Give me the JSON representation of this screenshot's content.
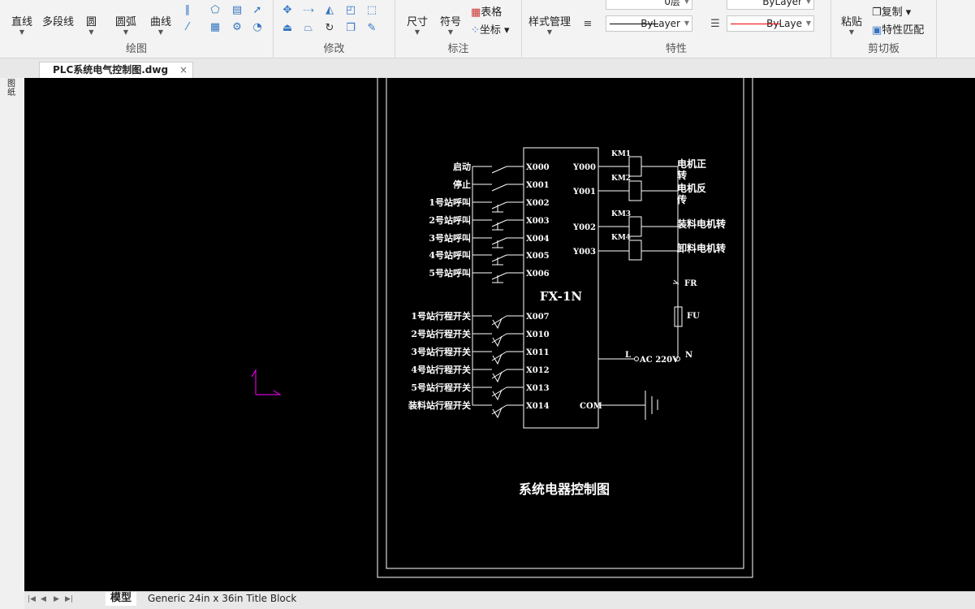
{
  "ribbon": {
    "draw": {
      "title": "绘图",
      "line": "直线",
      "polyline": "多段线",
      "circle": "圆",
      "arc": "圆弧",
      "curve": "曲线"
    },
    "modify": {
      "title": "修改"
    },
    "annotate": {
      "title": "标注",
      "dimension": "尺寸",
      "symbol": "符号",
      "table": "表格",
      "coord": "坐标"
    },
    "properties": {
      "title": "特性",
      "style_manager": "样式管理",
      "layer": "0层",
      "color": "ByLayer",
      "linetype": "ByLayer",
      "lineweight": "ByLaye"
    },
    "clipboard": {
      "title": "剪切板",
      "paste": "粘贴",
      "copy": "复制",
      "match": "特性匹配"
    }
  },
  "tabs": {
    "document": "PLC系统电气控制图.dwg",
    "close": "×"
  },
  "left_tool": "图纸",
  "bottom": {
    "model": "模型",
    "layout": "Generic 24in x 36in Title Block"
  },
  "drawing": {
    "plc": "FX-1N",
    "title": "系统电器控制图",
    "inputs": [
      {
        "label": "启动",
        "addr": "X000",
        "type": "no"
      },
      {
        "label": "停止",
        "addr": "X001",
        "type": "no"
      },
      {
        "label": "1号站呼叫",
        "addr": "X002",
        "type": "btn"
      },
      {
        "label": "2号站呼叫",
        "addr": "X003",
        "type": "btn"
      },
      {
        "label": "3号站呼叫",
        "addr": "X004",
        "type": "btn"
      },
      {
        "label": "4号站呼叫",
        "addr": "X005",
        "type": "btn"
      },
      {
        "label": "5号站呼叫",
        "addr": "X006",
        "type": "btn"
      },
      {
        "label": "1号站行程开关",
        "addr": "X007",
        "type": "limit"
      },
      {
        "label": "2号站行程开关",
        "addr": "X010",
        "type": "limit"
      },
      {
        "label": "3号站行程开关",
        "addr": "X011",
        "type": "limit"
      },
      {
        "label": "4号站行程开关",
        "addr": "X012",
        "type": "limit"
      },
      {
        "label": "5号站行程开关",
        "addr": "X013",
        "type": "limit"
      },
      {
        "label": "装料站行程开关",
        "addr": "X014",
        "type": "limit"
      }
    ],
    "outputs": [
      {
        "addr": "Y000",
        "coil": "KM1",
        "label": "电机正",
        "label2": "转"
      },
      {
        "addr": "Y001",
        "coil": "KM2",
        "label": "电机反",
        "label2": "传"
      },
      {
        "addr": "Y002",
        "coil": "KM3",
        "label": "装料电机转",
        "label2": ""
      },
      {
        "addr": "Y003",
        "coil": "KM4",
        "label": "卸料电机转",
        "label2": ""
      }
    ],
    "fr": "FR",
    "fu": "FU",
    "l": "L",
    "ac": "AC 220V",
    "n": "N",
    "com": "COM"
  }
}
